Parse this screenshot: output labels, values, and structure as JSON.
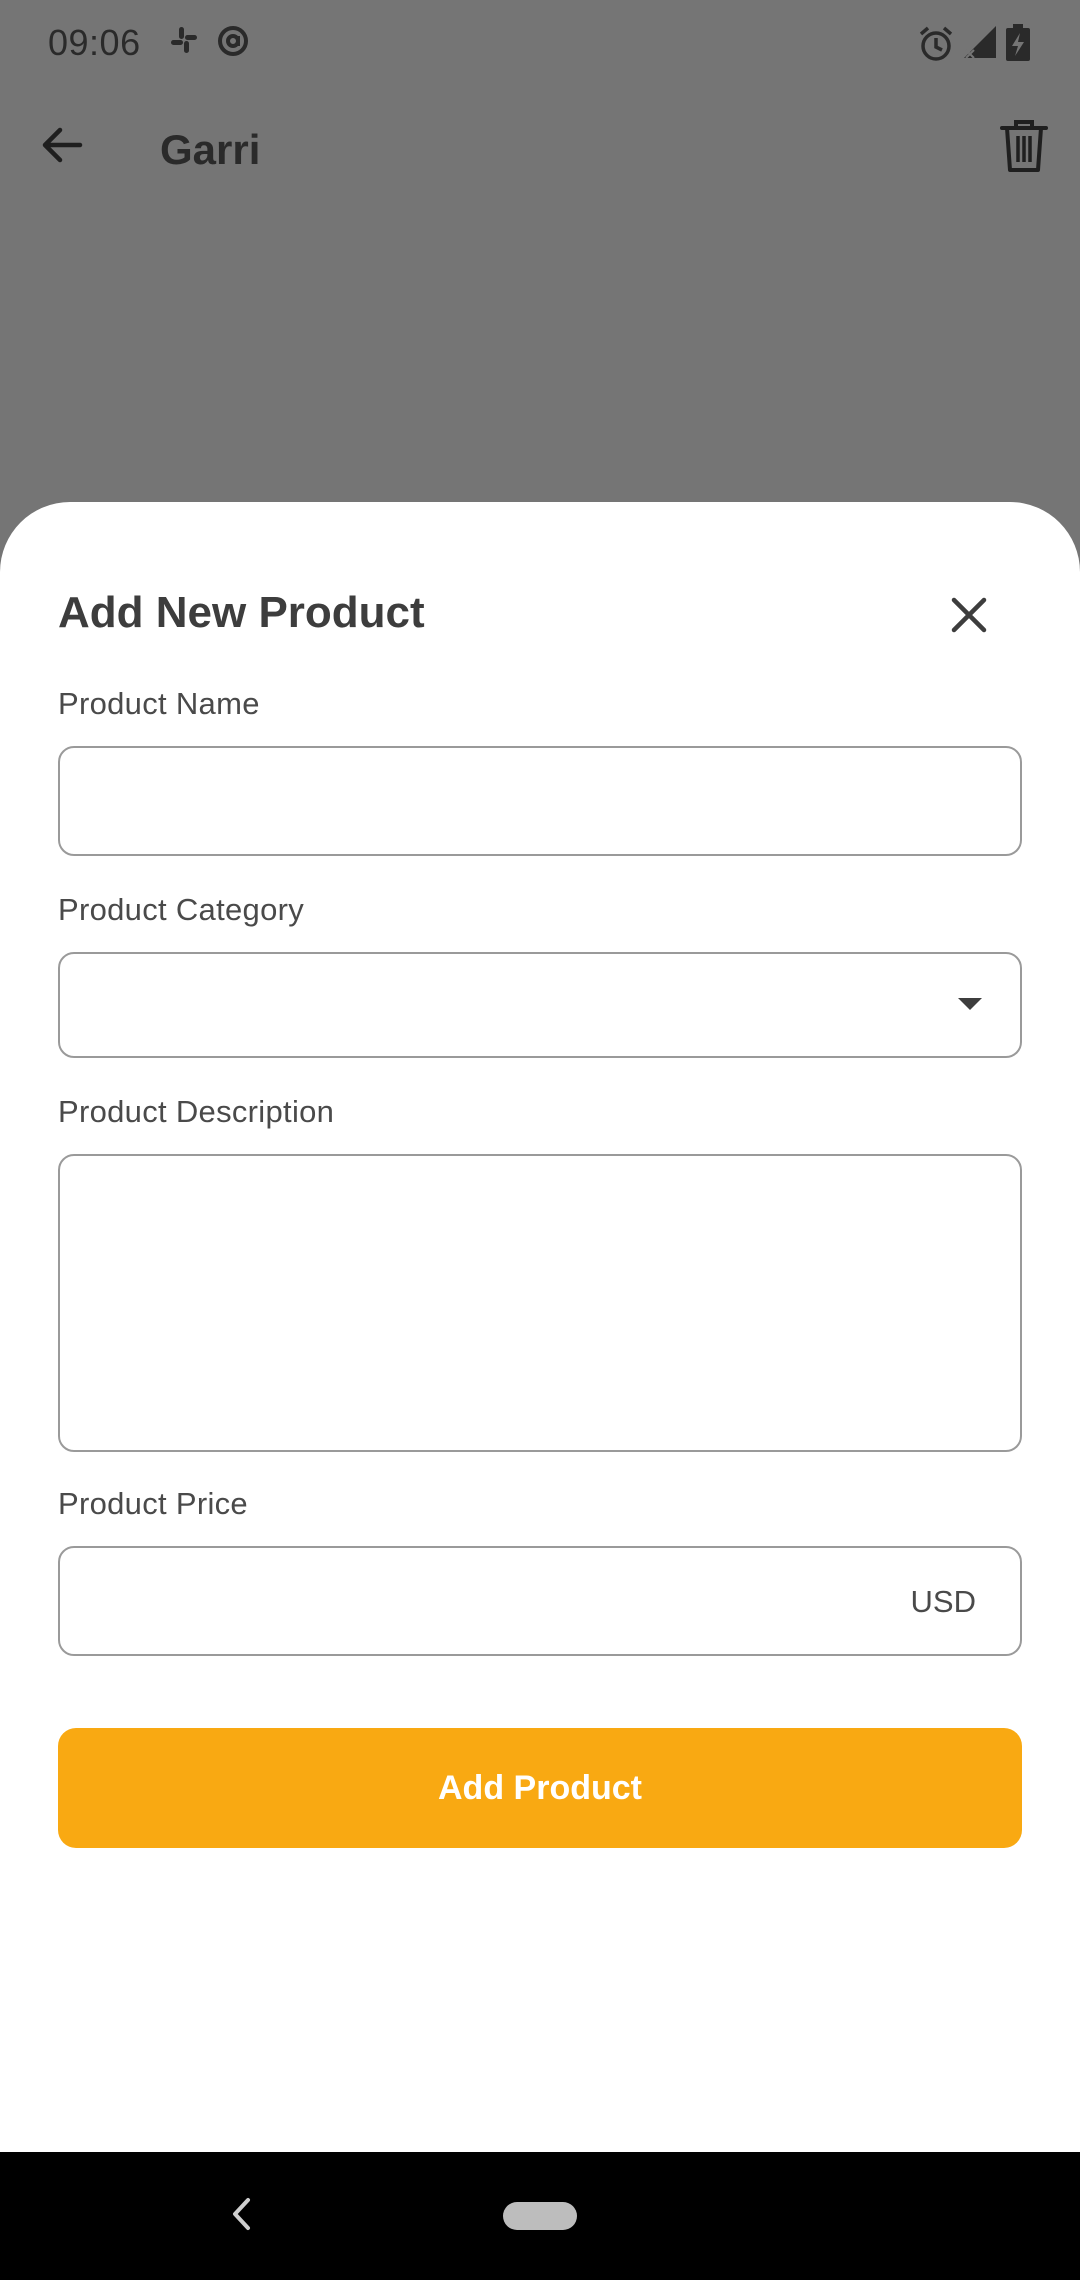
{
  "status_bar": {
    "time": "09:06",
    "left_icons": [
      "slack-icon",
      "at-sign-icon"
    ],
    "right_icons": [
      "alarm-icon",
      "signal-icon",
      "battery-charging-icon"
    ]
  },
  "app_bar": {
    "back_icon": "arrow-left-icon",
    "title": "Garri",
    "trash_icon": "trash-icon"
  },
  "sheet": {
    "title": "Add New Product",
    "close_icon": "close-icon",
    "fields": {
      "name_label": "Product Name",
      "name_value": "",
      "category_label": "Product Category",
      "category_value": "",
      "description_label": "Product Description",
      "description_value": "",
      "price_label": "Product Price",
      "price_value": "",
      "price_suffix": "USD"
    },
    "submit_label": "Add Product"
  },
  "colors": {
    "accent": "#f9a912",
    "scrim": "#757575",
    "sheet_bg": "#ffffff",
    "field_border": "#9a9a9a"
  },
  "nav_bar": {
    "back_icon": "chevron-left-icon",
    "home_icon": "home-pill-icon"
  }
}
